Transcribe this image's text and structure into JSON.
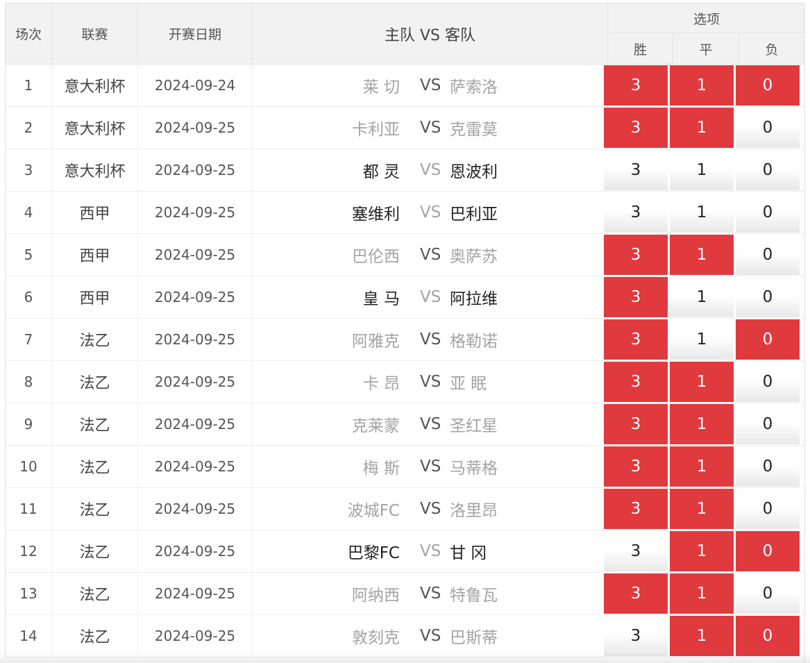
{
  "header": {
    "index": "场次",
    "league": "联赛",
    "date": "开赛日期",
    "match": "主队 VS 客队",
    "options_title": "选项",
    "options": [
      "胜",
      "平",
      "负"
    ]
  },
  "vs_label": "VS",
  "colors": {
    "selected": "#e0393e",
    "header_bg": "#f2f2f2",
    "dim_text": "#a3a3a3"
  },
  "rows": [
    {
      "index": "1",
      "league": "意大利杯",
      "date": "2024-09-24",
      "home": "莱 切",
      "away": "萨索洛",
      "odds": [
        "3",
        "1",
        "0"
      ],
      "selected": [
        true,
        true,
        true
      ],
      "active": false
    },
    {
      "index": "2",
      "league": "意大利杯",
      "date": "2024-09-25",
      "home": "卡利亚",
      "away": "克雷莫",
      "odds": [
        "3",
        "1",
        "0"
      ],
      "selected": [
        true,
        true,
        false
      ],
      "active": false
    },
    {
      "index": "3",
      "league": "意大利杯",
      "date": "2024-09-25",
      "home": "都 灵",
      "away": "恩波利",
      "odds": [
        "3",
        "1",
        "0"
      ],
      "selected": [
        false,
        false,
        false
      ],
      "active": true
    },
    {
      "index": "4",
      "league": "西甲",
      "date": "2024-09-25",
      "home": "塞维利",
      "away": "巴利亚",
      "odds": [
        "3",
        "1",
        "0"
      ],
      "selected": [
        false,
        false,
        false
      ],
      "active": true
    },
    {
      "index": "5",
      "league": "西甲",
      "date": "2024-09-25",
      "home": "巴伦西",
      "away": "奥萨苏",
      "odds": [
        "3",
        "1",
        "0"
      ],
      "selected": [
        true,
        true,
        false
      ],
      "active": false
    },
    {
      "index": "6",
      "league": "西甲",
      "date": "2024-09-25",
      "home": "皇 马",
      "away": "阿拉维",
      "odds": [
        "3",
        "1",
        "0"
      ],
      "selected": [
        true,
        false,
        false
      ],
      "active": true
    },
    {
      "index": "7",
      "league": "法乙",
      "date": "2024-09-25",
      "home": "阿雅克",
      "away": "格勒诺",
      "odds": [
        "3",
        "1",
        "0"
      ],
      "selected": [
        true,
        false,
        true
      ],
      "active": false
    },
    {
      "index": "8",
      "league": "法乙",
      "date": "2024-09-25",
      "home": "卡 昂",
      "away": "亚 眠",
      "odds": [
        "3",
        "1",
        "0"
      ],
      "selected": [
        true,
        true,
        false
      ],
      "active": false
    },
    {
      "index": "9",
      "league": "法乙",
      "date": "2024-09-25",
      "home": "克莱蒙",
      "away": "圣红星",
      "odds": [
        "3",
        "1",
        "0"
      ],
      "selected": [
        true,
        true,
        false
      ],
      "active": false
    },
    {
      "index": "10",
      "league": "法乙",
      "date": "2024-09-25",
      "home": "梅 斯",
      "away": "马蒂格",
      "odds": [
        "3",
        "1",
        "0"
      ],
      "selected": [
        true,
        true,
        false
      ],
      "active": false
    },
    {
      "index": "11",
      "league": "法乙",
      "date": "2024-09-25",
      "home": "波城FC",
      "away": "洛里昂",
      "odds": [
        "3",
        "1",
        "0"
      ],
      "selected": [
        true,
        true,
        false
      ],
      "active": false
    },
    {
      "index": "12",
      "league": "法乙",
      "date": "2024-09-25",
      "home": "巴黎FC",
      "away": "甘 冈",
      "odds": [
        "3",
        "1",
        "0"
      ],
      "selected": [
        false,
        true,
        true
      ],
      "active": true
    },
    {
      "index": "13",
      "league": "法乙",
      "date": "2024-09-25",
      "home": "阿纳西",
      "away": "特鲁瓦",
      "odds": [
        "3",
        "1",
        "0"
      ],
      "selected": [
        true,
        true,
        false
      ],
      "active": false
    },
    {
      "index": "14",
      "league": "法乙",
      "date": "2024-09-25",
      "home": "敦刻克",
      "away": "巴斯蒂",
      "odds": [
        "3",
        "1",
        "0"
      ],
      "selected": [
        false,
        true,
        true
      ],
      "active": false
    }
  ]
}
